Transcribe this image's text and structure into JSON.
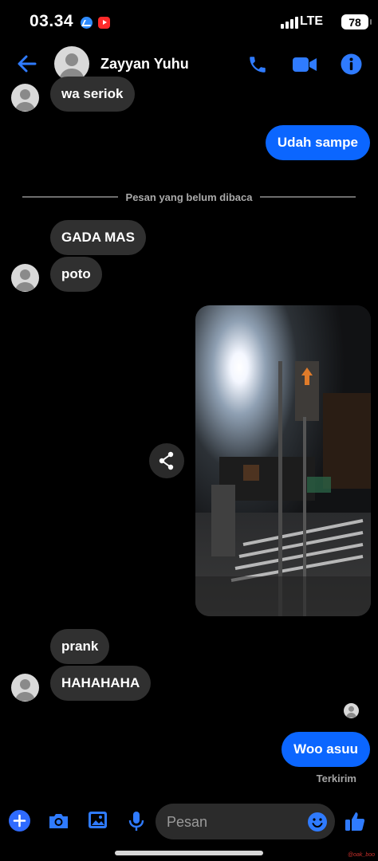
{
  "status_bar": {
    "time": "03.34",
    "network": "LTE",
    "battery": "78",
    "notification_apps": [
      "messenger-icon",
      "youtube-icon"
    ]
  },
  "header": {
    "contact_name": "Zayyan Yuhu",
    "icons": [
      "back-arrow-icon",
      "phone-icon",
      "video-call-icon",
      "info-icon"
    ]
  },
  "messages": {
    "m1_text": "wa seriok",
    "m2_text": "Udah sampe",
    "unread_divider": "Pesan yang belum dibaca",
    "m3_text": "GADA MAS",
    "m4_text": "poto",
    "m5_text": "prank",
    "m6_text": "HAHAHAHA",
    "m7_text": "Woo asuu"
  },
  "delivery_status": "Terkirim",
  "composer": {
    "placeholder": "Pesan",
    "icons": [
      "plus-icon",
      "camera-icon",
      "gallery-icon",
      "microphone-icon",
      "emoji-icon",
      "like-icon"
    ]
  },
  "watermark": "@oak_boo",
  "colors": {
    "accent": "#0b66ff",
    "incoming_bubble": "#303030",
    "background": "#000000"
  }
}
